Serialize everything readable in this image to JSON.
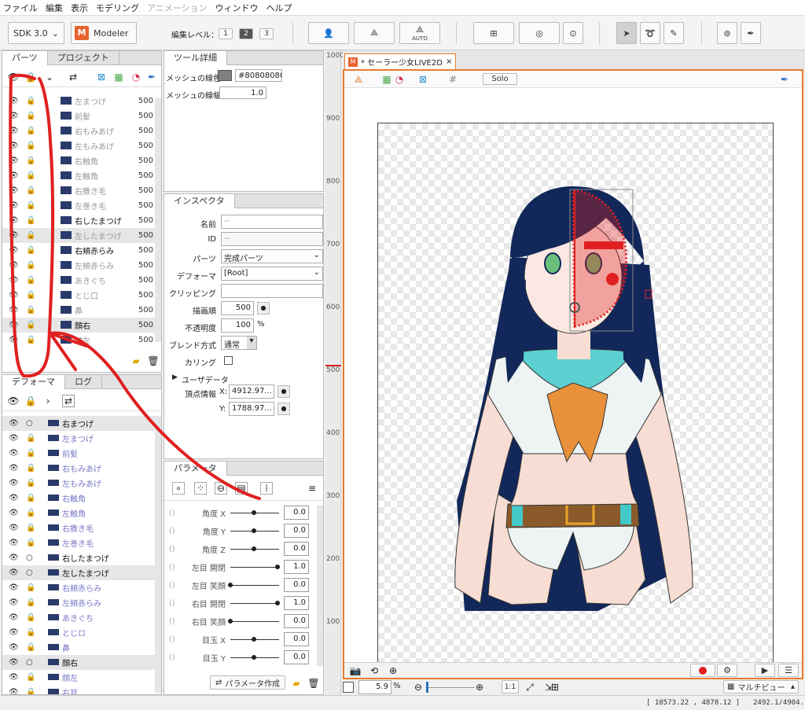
{
  "menu": [
    "ファイル",
    "編集",
    "表示",
    "モデリング",
    "アニメーション",
    "ウィンドウ",
    "ヘルプ"
  ],
  "toolbar": {
    "sdk_label": "SDK 3.0",
    "modeler_label": "Modeler",
    "edit_level_label": "編集レベル：",
    "levels": [
      "1",
      "2",
      "3"
    ],
    "auto_label": "AUTO"
  },
  "parts_panel": {
    "tabs": [
      "パーツ",
      "プロジェクト"
    ],
    "items": [
      {
        "name": "左まつげ",
        "value": "500"
      },
      {
        "name": "前髪",
        "value": "500"
      },
      {
        "name": "右もみあげ",
        "value": "500"
      },
      {
        "name": "左もみあげ",
        "value": "500"
      },
      {
        "name": "右触角",
        "value": "500"
      },
      {
        "name": "左触角",
        "value": "500"
      },
      {
        "name": "右撒き毛",
        "value": "500"
      },
      {
        "name": "左巻き毛",
        "value": "500"
      },
      {
        "name": "右したまつげ",
        "value": "500"
      },
      {
        "name": "左したまつげ",
        "value": "500"
      },
      {
        "name": "右頬赤らみ",
        "value": "500"
      },
      {
        "name": "左頬赤らみ",
        "value": "500"
      },
      {
        "name": "あきぐち",
        "value": "500"
      },
      {
        "name": "とじ口",
        "value": "500"
      },
      {
        "name": "鼻",
        "value": "500"
      },
      {
        "name": "顔右",
        "value": "500"
      },
      {
        "name": "顔左",
        "value": "500"
      }
    ]
  },
  "tool_detail": {
    "tab": "ツール詳細",
    "mesh_color_label": "メッシュの線色",
    "mesh_color_value": "#80808080",
    "mesh_width_label": "メッシュの線幅",
    "mesh_width_value": "1.0"
  },
  "inspector": {
    "tab": "インスペクタ",
    "name_label": "名前",
    "name_value": "--",
    "id_label": "ID",
    "id_value": "--",
    "parts_label": "パーツ",
    "parts_value": "完成パーツ",
    "deformer_label": "デフォーマ",
    "deformer_value": "[Root]",
    "clipping_label": "クリッピング",
    "draw_order_label": "描画順",
    "draw_order_value": "500",
    "opacity_label": "不透明度",
    "opacity_value": "100",
    "opacity_unit": "%",
    "blend_label": "ブレンド方式",
    "blend_value": "通常",
    "culling_label": "カリング",
    "userdata_label": "ユーザデータ",
    "vertex_label": "頂点情報",
    "x_label": "X:",
    "x_value": "4912.97...",
    "y_label": "Y:",
    "y_value": "1788.97..."
  },
  "deformer_panel": {
    "tabs": [
      "デフォーマ",
      "ログ"
    ],
    "items": [
      {
        "name": "右まつげ"
      },
      {
        "name": "左まつげ"
      },
      {
        "name": "前髪"
      },
      {
        "name": "右もみあげ"
      },
      {
        "name": "左もみあげ"
      },
      {
        "name": "右触角"
      },
      {
        "name": "左触角"
      },
      {
        "name": "右撒き毛"
      },
      {
        "name": "左巻き毛"
      },
      {
        "name": "右したまつげ"
      },
      {
        "name": "左したまつげ"
      },
      {
        "name": "右頬赤らみ"
      },
      {
        "name": "左頬赤らみ"
      },
      {
        "name": "あきぐち"
      },
      {
        "name": "とじロ"
      },
      {
        "name": "鼻"
      },
      {
        "name": "顔右"
      },
      {
        "name": "顔左"
      },
      {
        "name": "右耳"
      }
    ]
  },
  "parameter_panel": {
    "tab": "パラメータ",
    "params": [
      {
        "name": "角度 X",
        "value": "0.0",
        "level": 0.5
      },
      {
        "name": "角度 Y",
        "value": "0.0",
        "level": 0.5
      },
      {
        "name": "角度 Z",
        "value": "0.0",
        "level": 0.5
      },
      {
        "name": "左目 開閉",
        "value": "1.0",
        "level": 1.0
      },
      {
        "name": "左目 笑顔",
        "value": "0.0",
        "level": 0.0
      },
      {
        "name": "右目 開閉",
        "value": "1.0",
        "level": 1.0
      },
      {
        "name": "右目 笑顔",
        "value": "0.0",
        "level": 0.0
      },
      {
        "name": "目玉 X",
        "value": "0.0",
        "level": 0.5
      },
      {
        "name": "目玉 Y",
        "value": "0.0",
        "level": 0.5
      }
    ],
    "create_button": "パラメータ作成"
  },
  "canvas": {
    "doc_tab": "* セーラー少女LIVE2D",
    "solo_label": "Solo",
    "ruler_marks": [
      "1000",
      "900",
      "800",
      "700",
      "600",
      "500",
      "400",
      "300",
      "200",
      "100"
    ],
    "zoom_value": "5.9",
    "zoom_unit": "%",
    "one_to_one": "1:1",
    "view_mode": "マルチビュー"
  },
  "status": {
    "coords": "[ 10573.22 , 4878.12 ]",
    "position": "2492.1/4904."
  },
  "colors": {
    "annotation_red": "#e02020",
    "accent_orange": "#e87b2b",
    "hair_navy": "#12285a"
  }
}
